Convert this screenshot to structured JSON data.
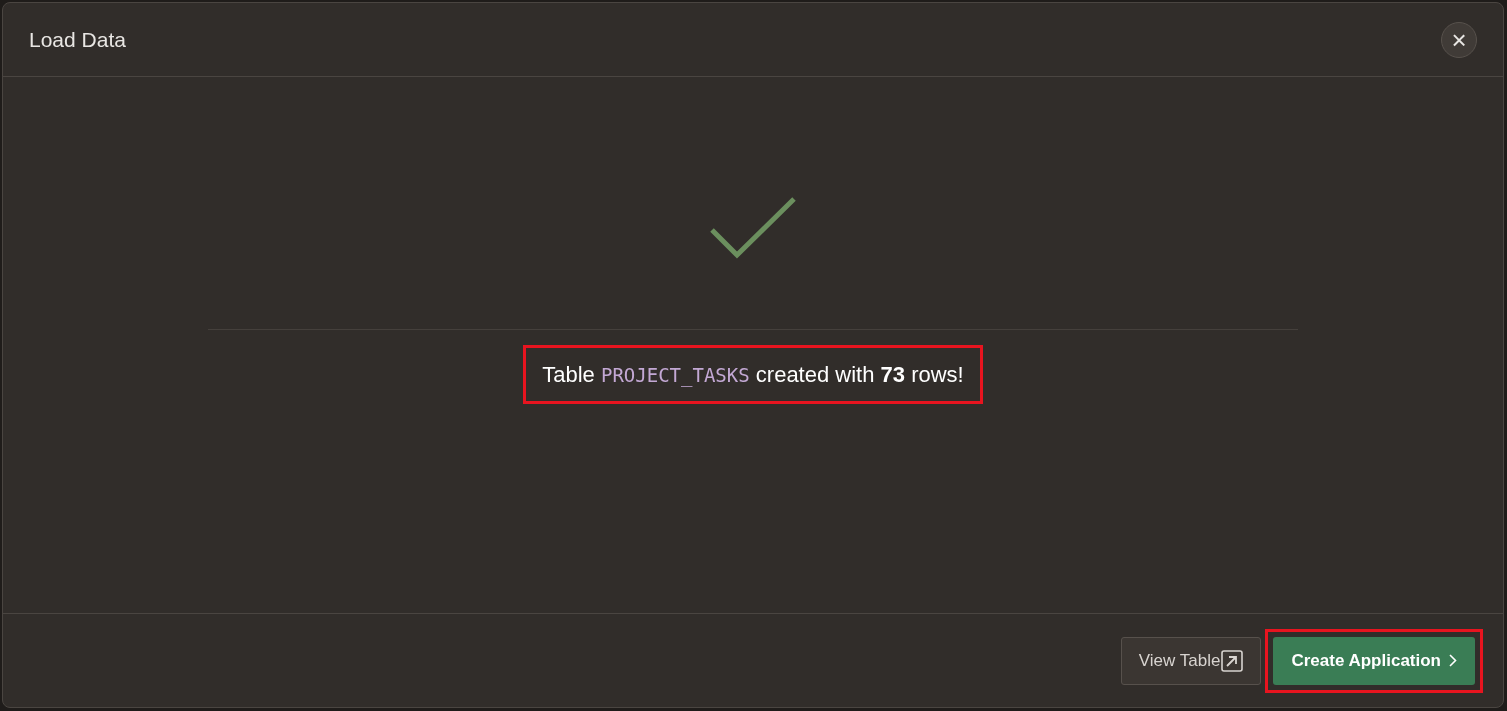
{
  "dialog": {
    "title": "Load Data",
    "close_icon": "×"
  },
  "result": {
    "before": "Table",
    "table_name": "PROJECT_TASKS",
    "after": "created with **73** rows!",
    "highlighted": true
  },
  "buttons": [
    {
      "kind": "secondary",
      "label": "View Table",
      "highlighted": false
    },
    {
      "kind": "primary",
      "label": "Create Application",
      "highlighted": true
    }
  ]
}
